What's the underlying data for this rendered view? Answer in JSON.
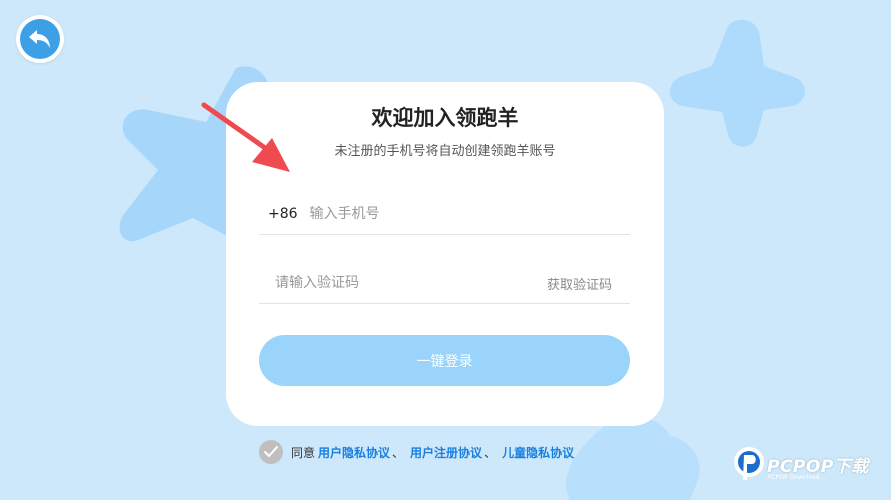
{
  "header": {
    "back_icon": "back-arrow-icon"
  },
  "card": {
    "title": "欢迎加入领跑羊",
    "subtitle": "未注册的手机号将自动创建领跑羊账号",
    "phone": {
      "prefix": "+86",
      "placeholder": "输入手机号",
      "value": ""
    },
    "code": {
      "placeholder": "请输入验证码",
      "value": "",
      "get_code_label": "获取验证码"
    },
    "login_label": "一键登录"
  },
  "agreement": {
    "checked": false,
    "prefix": "同意",
    "links": [
      "用户隐私协议",
      "用户注册协议",
      "儿童隐私协议"
    ],
    "separator": "、"
  },
  "watermark": {
    "brand": "PCPOP下载",
    "sub": "PCPOP Download"
  },
  "colors": {
    "background": "#cde8fb",
    "accent": "#3d9fe6",
    "login_button": "#9ad4fa",
    "link": "#1a7fdd",
    "annotation_arrow": "#ef4a50"
  }
}
